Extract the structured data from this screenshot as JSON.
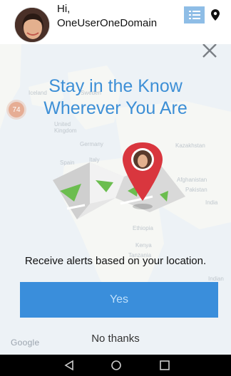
{
  "header": {
    "greeting": "Hi,",
    "username": "OneUserOneDomain"
  },
  "map": {
    "cluster_count": "74",
    "labels": [
      "Iceland",
      "Sweden",
      "United Kingdom",
      "Germany",
      "Italy",
      "Spain",
      "Kazakhstan",
      "Afghanistan",
      "Pakistan",
      "India",
      "Ethiopia",
      "Kenya",
      "Tanzania",
      "Indian"
    ],
    "attribution": "Google"
  },
  "dialog": {
    "title_line1": "Stay in the Know",
    "title_line2": "Wherever You Are",
    "message": "Receive alerts based on your location.",
    "yes_label": "Yes",
    "no_label": "No thanks"
  },
  "colors": {
    "accent": "#3d8fd6",
    "button": "#3a8edb",
    "pin": "#d9363e"
  },
  "icons": [
    "list-icon",
    "map-pin-icon",
    "close-icon",
    "back-icon",
    "home-icon",
    "recents-icon"
  ]
}
